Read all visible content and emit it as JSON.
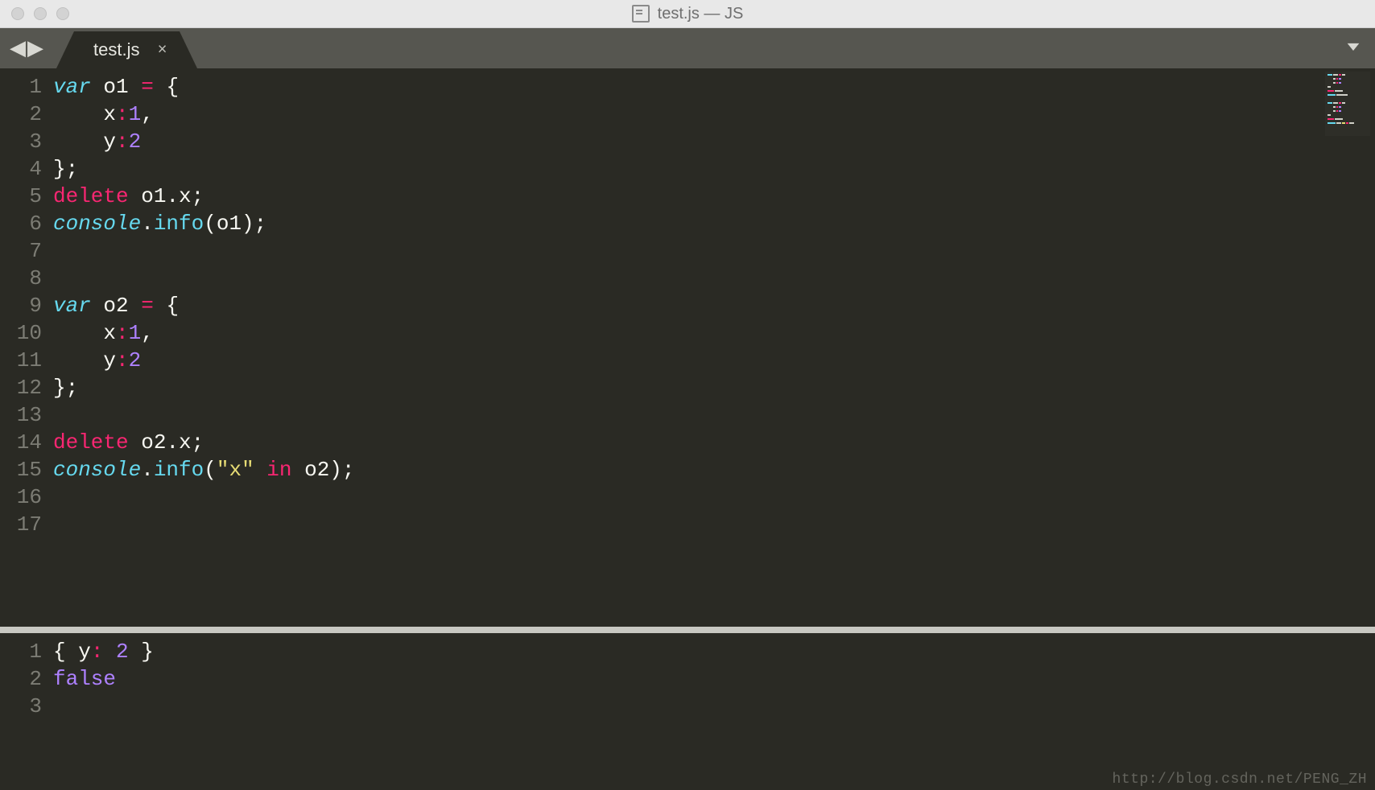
{
  "window": {
    "title": "test.js — JS"
  },
  "tabbar": {
    "nav_back": "◀",
    "nav_forward": "▶",
    "tabs": [
      {
        "label": "test.js",
        "close": "×"
      }
    ]
  },
  "editor": {
    "lines": [
      {
        "n": "1",
        "tokens": [
          [
            "kw-decl",
            "var "
          ],
          [
            "ident",
            "o1 "
          ],
          [
            "kw-red",
            "="
          ],
          [
            "punc",
            " {"
          ]
        ]
      },
      {
        "n": "2",
        "tokens": [
          [
            "punc",
            "    x"
          ],
          [
            "kw-red",
            ":"
          ],
          [
            "num",
            "1"
          ],
          [
            "punc",
            ","
          ]
        ]
      },
      {
        "n": "3",
        "tokens": [
          [
            "punc",
            "    y"
          ],
          [
            "kw-red",
            ":"
          ],
          [
            "num",
            "2"
          ]
        ]
      },
      {
        "n": "4",
        "tokens": [
          [
            "punc",
            "};"
          ]
        ]
      },
      {
        "n": "5",
        "tokens": [
          [
            "kw-red",
            "delete"
          ],
          [
            "ident",
            " o1"
          ],
          [
            "punc",
            ".x;"
          ]
        ]
      },
      {
        "n": "6",
        "tokens": [
          [
            "kw-decl",
            "console"
          ],
          [
            "punc",
            "."
          ],
          [
            "method",
            "info"
          ],
          [
            "punc",
            "(o1);"
          ]
        ]
      },
      {
        "n": "7",
        "tokens": []
      },
      {
        "n": "8",
        "tokens": []
      },
      {
        "n": "9",
        "tokens": [
          [
            "kw-decl",
            "var "
          ],
          [
            "ident",
            "o2 "
          ],
          [
            "kw-red",
            "="
          ],
          [
            "punc",
            " {"
          ]
        ]
      },
      {
        "n": "10",
        "tokens": [
          [
            "punc",
            "    x"
          ],
          [
            "kw-red",
            ":"
          ],
          [
            "num",
            "1"
          ],
          [
            "punc",
            ","
          ]
        ]
      },
      {
        "n": "11",
        "tokens": [
          [
            "punc",
            "    y"
          ],
          [
            "kw-red",
            ":"
          ],
          [
            "num",
            "2"
          ]
        ]
      },
      {
        "n": "12",
        "tokens": [
          [
            "punc",
            "};"
          ]
        ]
      },
      {
        "n": "13",
        "tokens": []
      },
      {
        "n": "14",
        "tokens": [
          [
            "kw-red",
            "delete"
          ],
          [
            "ident",
            " o2"
          ],
          [
            "punc",
            ".x;"
          ]
        ]
      },
      {
        "n": "15",
        "tokens": [
          [
            "kw-decl",
            "console"
          ],
          [
            "punc",
            "."
          ],
          [
            "method",
            "info"
          ],
          [
            "punc",
            "("
          ],
          [
            "str",
            "\"x\""
          ],
          [
            "punc",
            " "
          ],
          [
            "kw-red",
            "in"
          ],
          [
            "punc",
            " o2);"
          ]
        ]
      },
      {
        "n": "16",
        "tokens": []
      },
      {
        "n": "17",
        "tokens": []
      }
    ]
  },
  "console": {
    "lines": [
      {
        "n": "1",
        "tokens": [
          [
            "punc",
            "{ y"
          ],
          [
            "kw-red",
            ":"
          ],
          [
            "punc",
            " "
          ],
          [
            "num",
            "2"
          ],
          [
            "punc",
            " }"
          ]
        ]
      },
      {
        "n": "2",
        "tokens": [
          [
            "num",
            "false"
          ]
        ]
      },
      {
        "n": "3",
        "tokens": []
      }
    ]
  },
  "watermark": "http://blog.csdn.net/PENG_ZH"
}
